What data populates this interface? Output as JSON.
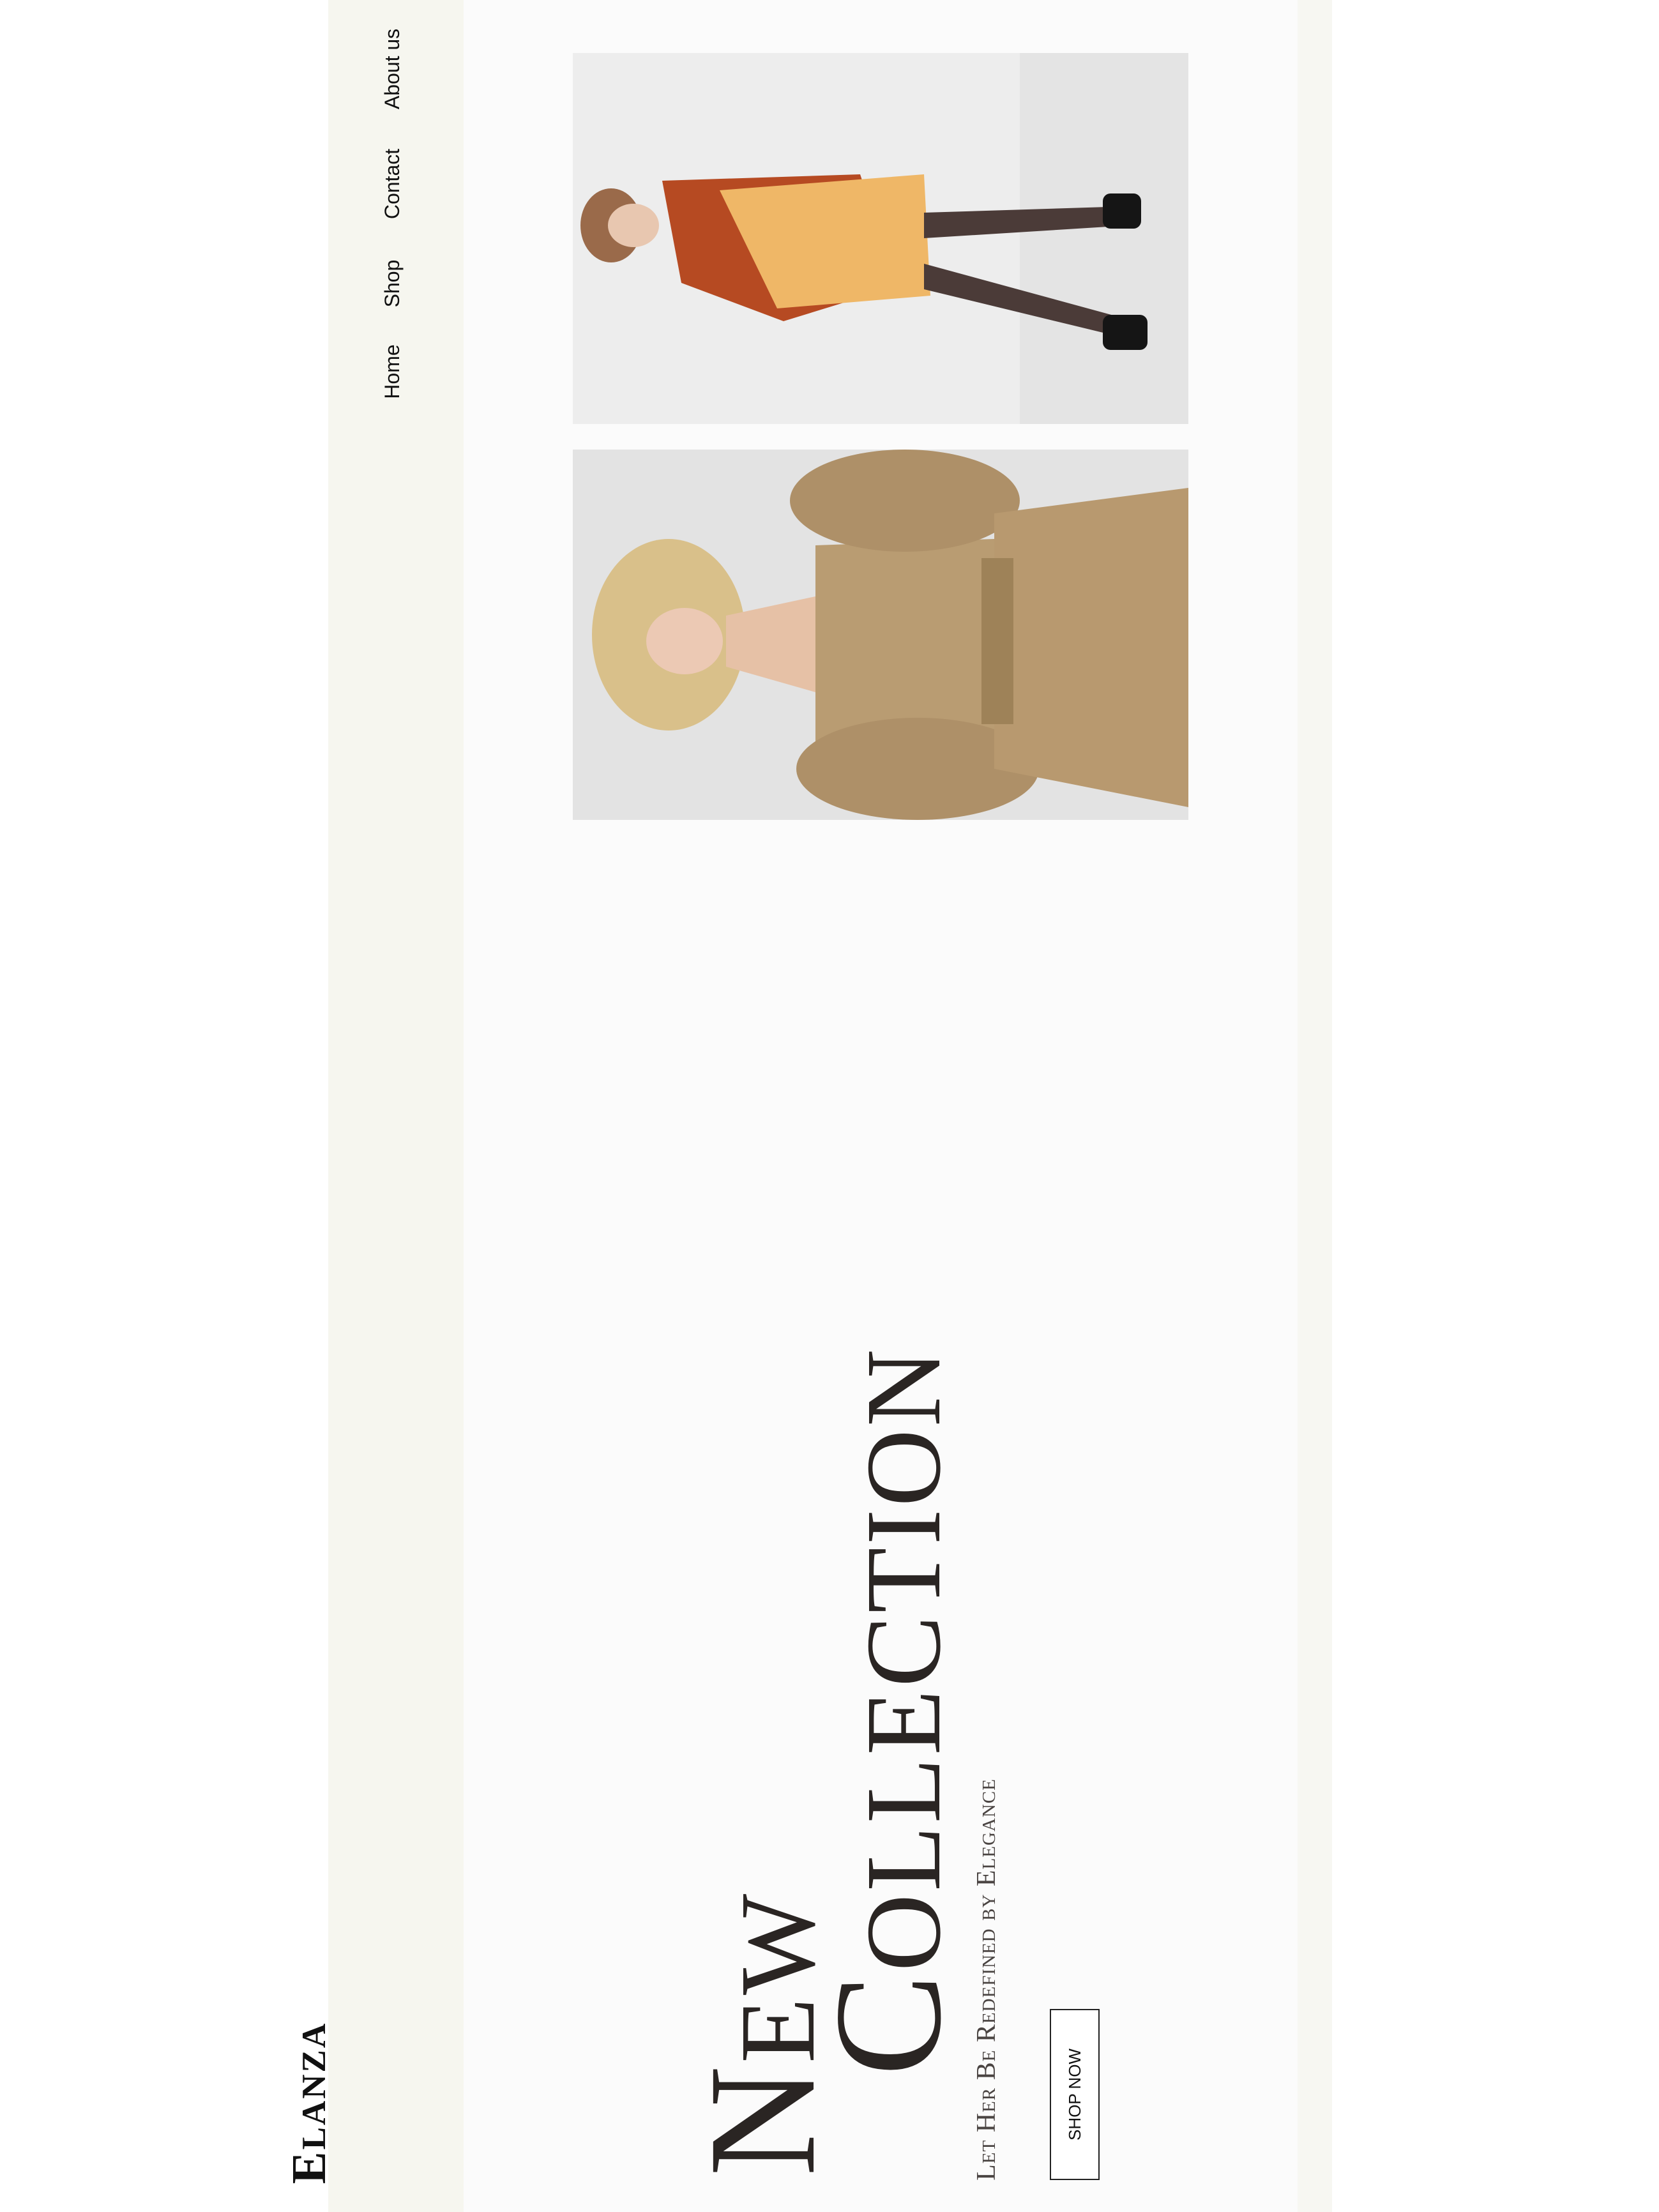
{
  "brand": {
    "name": "Elanza"
  },
  "nav": {
    "items": [
      {
        "label": "Home"
      },
      {
        "label": "Shop"
      },
      {
        "label": "Contact"
      },
      {
        "label": "About us"
      }
    ]
  },
  "hero": {
    "title_line1": "New",
    "title_line2": "Collection",
    "subtitle": "Let Her Be Redefined by Elegance",
    "cta_label": "SHOP NOW"
  },
  "products": [
    {
      "kind": "photo",
      "subject": "woman in rust sweater and mustard dress"
    },
    {
      "kind": "photo",
      "subject": "woman in beige linen outfit"
    }
  ],
  "colors": {
    "page_background": "#f7f7f2",
    "hero_background": "#fbfbfb",
    "text_dark": "#2a2523"
  }
}
